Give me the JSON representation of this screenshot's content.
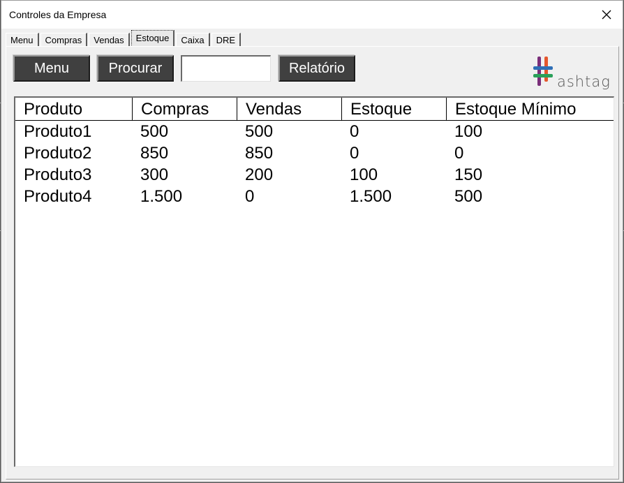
{
  "window": {
    "title": "Controles da Empresa"
  },
  "tabs": [
    {
      "label": "Menu",
      "active": false
    },
    {
      "label": "Compras",
      "active": false
    },
    {
      "label": "Vendas",
      "active": false
    },
    {
      "label": "Estoque",
      "active": true
    },
    {
      "label": "Caixa",
      "active": false
    },
    {
      "label": "DRE",
      "active": false
    }
  ],
  "toolbar": {
    "menu_label": "Menu",
    "search_label": "Procurar",
    "search_value": "",
    "report_label": "Relatório"
  },
  "logo": {
    "text": "ashtag",
    "name": "hashtag-logo"
  },
  "table": {
    "headers": [
      "Produto",
      "Compras",
      "Vendas",
      "Estoque",
      "Estoque Mínimo"
    ],
    "rows": [
      [
        "Produto1",
        "500",
        "500",
        "0",
        "100"
      ],
      [
        "Produto2",
        "850",
        "850",
        "0",
        "0"
      ],
      [
        "Produto3",
        "300",
        "200",
        "100",
        "150"
      ],
      [
        "Produto4",
        "1.500",
        "0",
        "1.500",
        "500"
      ]
    ]
  },
  "colors": {
    "button_bg": "#404040",
    "button_text": "#ffffff",
    "window_bg": "#f0f0f0",
    "logo_purple": "#7a2e7a",
    "logo_orange": "#e4572e",
    "logo_blue": "#2e6fb7",
    "logo_green": "#2aa05a"
  }
}
